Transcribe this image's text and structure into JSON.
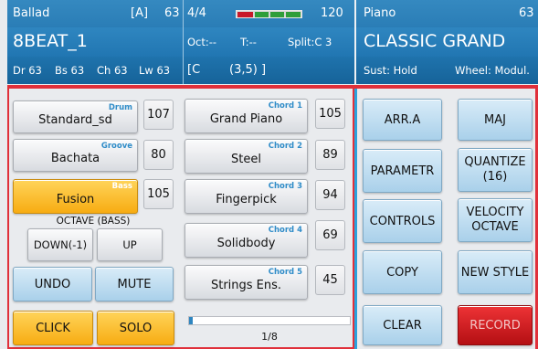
{
  "header": {
    "style": {
      "name": "Ballad",
      "bank": "[A]",
      "volume": "63",
      "variation": "8BEAT_1",
      "parts": [
        "Dr 63",
        "Bs 63",
        "Ch 63",
        "Lw 63"
      ]
    },
    "transport": {
      "time_signature": "4/4",
      "tempo": "120",
      "octave": "Oct:--",
      "transpose": "T:--",
      "split": "Split:C 3",
      "chord": "[C",
      "chord_extra": "(3,5) ]"
    },
    "voice": {
      "category": "Piano",
      "volume": "63",
      "name": "CLASSIC GRAND",
      "sustain": "Sust: Hold",
      "wheel": "Wheel: Modul."
    }
  },
  "left": {
    "drum": {
      "name": "Standard_sd",
      "tag": "Drum",
      "value": "107"
    },
    "groove": {
      "name": "Bachata",
      "tag": "Groove",
      "value": "80"
    },
    "bass": {
      "name": "Fusion",
      "tag": "Bass",
      "value": "105"
    },
    "octave_label": "OCTAVE (BASS)",
    "octave_down": "DOWN(-1)",
    "octave_up": "UP",
    "undo": "UNDO",
    "mute": "MUTE",
    "click": "CLICK",
    "solo": "SOLO"
  },
  "chords": [
    {
      "tag": "Chord 1",
      "name": "Grand Piano",
      "value": "105"
    },
    {
      "tag": "Chord 2",
      "name": "Steel",
      "value": "89"
    },
    {
      "tag": "Chord 3",
      "name": "Fingerpick",
      "value": "94"
    },
    {
      "tag": "Chord 4",
      "name": "Solidbody",
      "value": "69"
    },
    {
      "tag": "Chord 5",
      "name": "Strings Ens.",
      "value": "45"
    }
  ],
  "pager": {
    "page": "1/8",
    "progress": 0.02
  },
  "right": {
    "arr": "ARR.A",
    "maj": "MAJ",
    "parametr": "PARAMETR",
    "quantize_1": "QUANTIZE",
    "quantize_2": "(16)",
    "controls": "CONTROLS",
    "velocity_1": "VELOCITY",
    "velocity_2": "OCTAVE",
    "copy": "COPY",
    "new_style": "NEW STYLE",
    "clear": "CLEAR",
    "record": "RECORD"
  },
  "colors": {
    "header_blue": "#2a7db6",
    "frame_red": "#e0303a",
    "frame_blue": "#2aa2dd",
    "orange": "#f7ac12",
    "button_blue": "#a9d0ea",
    "record_red": "#c8181c",
    "meter_red": "#c8182a",
    "meter_green": "#2f9e3a"
  },
  "icons": {
    "level_meter": "level-meter-icon"
  }
}
